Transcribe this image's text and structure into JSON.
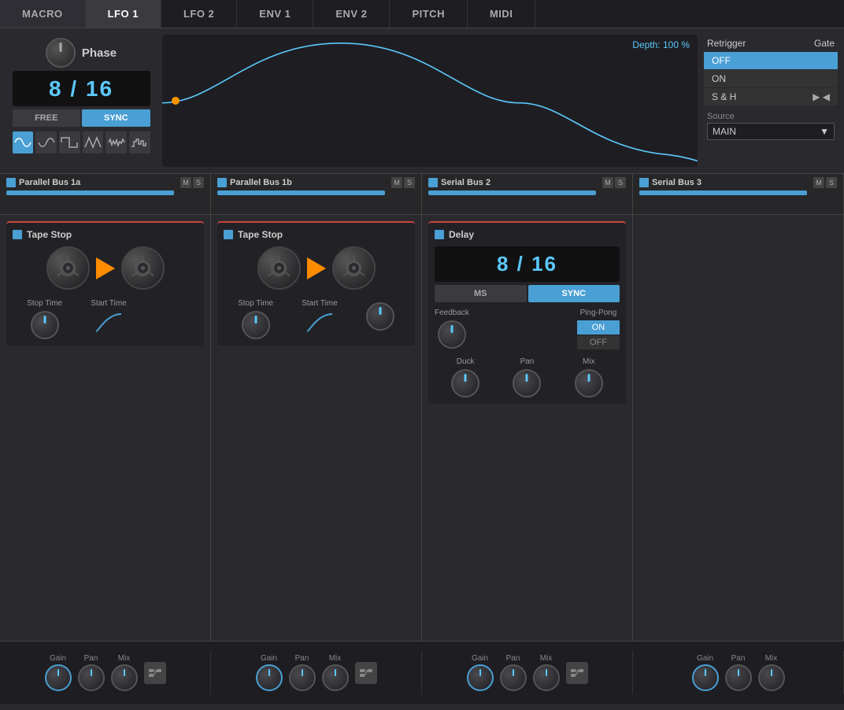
{
  "nav": {
    "tabs": [
      "MACRO",
      "LFO 1",
      "LFO 2",
      "ENV 1",
      "ENV 2",
      "PITCH",
      "MIDI"
    ],
    "active": "LFO 1"
  },
  "lfo": {
    "phase_label": "Phase",
    "rate": "8 / 16",
    "depth_label": "Depth: 100 %",
    "free_label": "FREE",
    "sync_label": "SYNC",
    "waveforms": [
      "sine",
      "inv-sine",
      "square",
      "tri",
      "noise",
      "step"
    ]
  },
  "retrigger": {
    "title": "Retrigger",
    "gate_label": "Gate",
    "options": [
      "OFF",
      "ON",
      "S & H"
    ],
    "selected": "OFF",
    "source_label": "Source",
    "source_value": "MAIN"
  },
  "buses": [
    {
      "name": "Parallel Bus 1a",
      "m": "M",
      "s": "S"
    },
    {
      "name": "Parallel Bus 1b",
      "m": "M",
      "s": "S"
    },
    {
      "name": "Serial Bus 2",
      "m": "M",
      "s": "S"
    },
    {
      "name": "Serial Bus 3",
      "m": "M",
      "s": "S"
    }
  ],
  "columns": [
    {
      "type": "tape_stop",
      "title": "Tape Stop",
      "knobs": [
        {
          "label": "Stop Time"
        },
        {
          "label": "Start Time"
        }
      ],
      "gain_label": "Gain",
      "pan_label": "Pan",
      "mix_label": "Mix"
    },
    {
      "type": "tape_stop",
      "title": "Tape Stop",
      "knobs": [
        {
          "label": "Stop Time"
        },
        {
          "label": "Start Time"
        }
      ],
      "gain_label": "Gain",
      "pan_label": "Pan",
      "mix_label": "Mix"
    },
    {
      "type": "delay",
      "title": "Delay",
      "rate": "8 / 16",
      "ms_label": "MS",
      "sync_label": "SYNC",
      "feedback_label": "Feedback",
      "ping_pong_label": "Ping-Pong",
      "ping_on": "ON",
      "ping_off": "OFF",
      "duck_label": "Duck",
      "pan_label": "Pan",
      "mix_label": "Mix",
      "gain_label": "Gain"
    },
    {
      "type": "empty",
      "title": "Serial Bus 3",
      "gain_label": "Gain",
      "pan_label": "Pan",
      "mix_label": "Mix"
    }
  ],
  "bottom": {
    "channels": [
      {
        "gain": "Gain",
        "pan": "Pan",
        "mix": "Mix"
      },
      {
        "gain": "Gain",
        "pan": "Pan",
        "mix": "Mix"
      },
      {
        "gain": "Gain",
        "pan": "Pan",
        "mix": "Mix"
      },
      {
        "gain": "Gain",
        "pan": "Pan",
        "mix": "Mix"
      }
    ]
  }
}
